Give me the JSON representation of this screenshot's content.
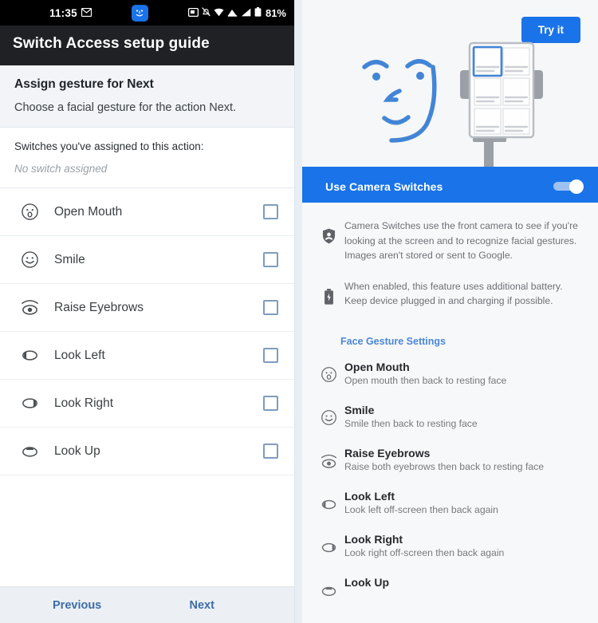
{
  "left_phone": {
    "status_bar": {
      "time": "11:35",
      "battery_percent": "81%",
      "icons": [
        "mail-icon",
        "face-switch-icon",
        "screenshot-icon",
        "notifications-off-icon",
        "wifi-icon",
        "cast-icon",
        "signal-icon",
        "battery-icon"
      ]
    },
    "app_bar": {
      "title": "Switch Access setup guide"
    },
    "header": {
      "heading": "Assign gesture for Next",
      "subheading": "Choose a facial gesture for the action Next."
    },
    "assigned": {
      "label": "Switches you've assigned to this action:",
      "value": "No switch assigned"
    },
    "gestures": [
      {
        "label": "Open Mouth",
        "icon": "open-mouth-icon",
        "checked": false
      },
      {
        "label": "Smile",
        "icon": "smile-icon",
        "checked": false
      },
      {
        "label": "Raise Eyebrows",
        "icon": "raise-eyebrows-icon",
        "checked": false
      },
      {
        "label": "Look Left",
        "icon": "look-left-icon",
        "checked": false
      },
      {
        "label": "Look Right",
        "icon": "look-right-icon",
        "checked": false
      },
      {
        "label": "Look Up",
        "icon": "look-up-icon",
        "checked": false
      }
    ],
    "footer": {
      "previous": "Previous",
      "next": "Next"
    }
  },
  "right_phone": {
    "hero": {
      "try_it_label": "Try it",
      "illustration": "face-and-device-illustration"
    },
    "camera_switches": {
      "label": "Use Camera Switches",
      "toggle_on": true
    },
    "info_rows": [
      {
        "icon": "privacy-shield-icon",
        "text": "Camera Switches use the front camera to see if you're looking at the screen and to recognize facial gestures. Images aren't stored or sent to Google."
      },
      {
        "icon": "battery-icon",
        "text": "When enabled, this feature uses additional battery. Keep device plugged in and charging if possible."
      }
    ],
    "section_header": "Face Gesture Settings",
    "gestures": [
      {
        "title": "Open Mouth",
        "desc": "Open mouth then back to resting face",
        "icon": "open-mouth-icon"
      },
      {
        "title": "Smile",
        "desc": "Smile then back to resting face",
        "icon": "smile-icon"
      },
      {
        "title": "Raise Eyebrows",
        "desc": "Raise both eyebrows then back to resting face",
        "icon": "raise-eyebrows-icon"
      },
      {
        "title": "Look Left",
        "desc": "Look left off-screen then back again",
        "icon": "look-left-icon"
      },
      {
        "title": "Look Right",
        "desc": "Look right off-screen then back again",
        "icon": "look-right-icon"
      },
      {
        "title": "Look Up",
        "desc": "",
        "icon": "look-up-icon"
      }
    ]
  },
  "colors": {
    "accent_blue": "#1a73e8",
    "app_bar_dark": "#202124",
    "link_blue": "#4a87d6",
    "checkbox_border": "#7e9dbd"
  }
}
